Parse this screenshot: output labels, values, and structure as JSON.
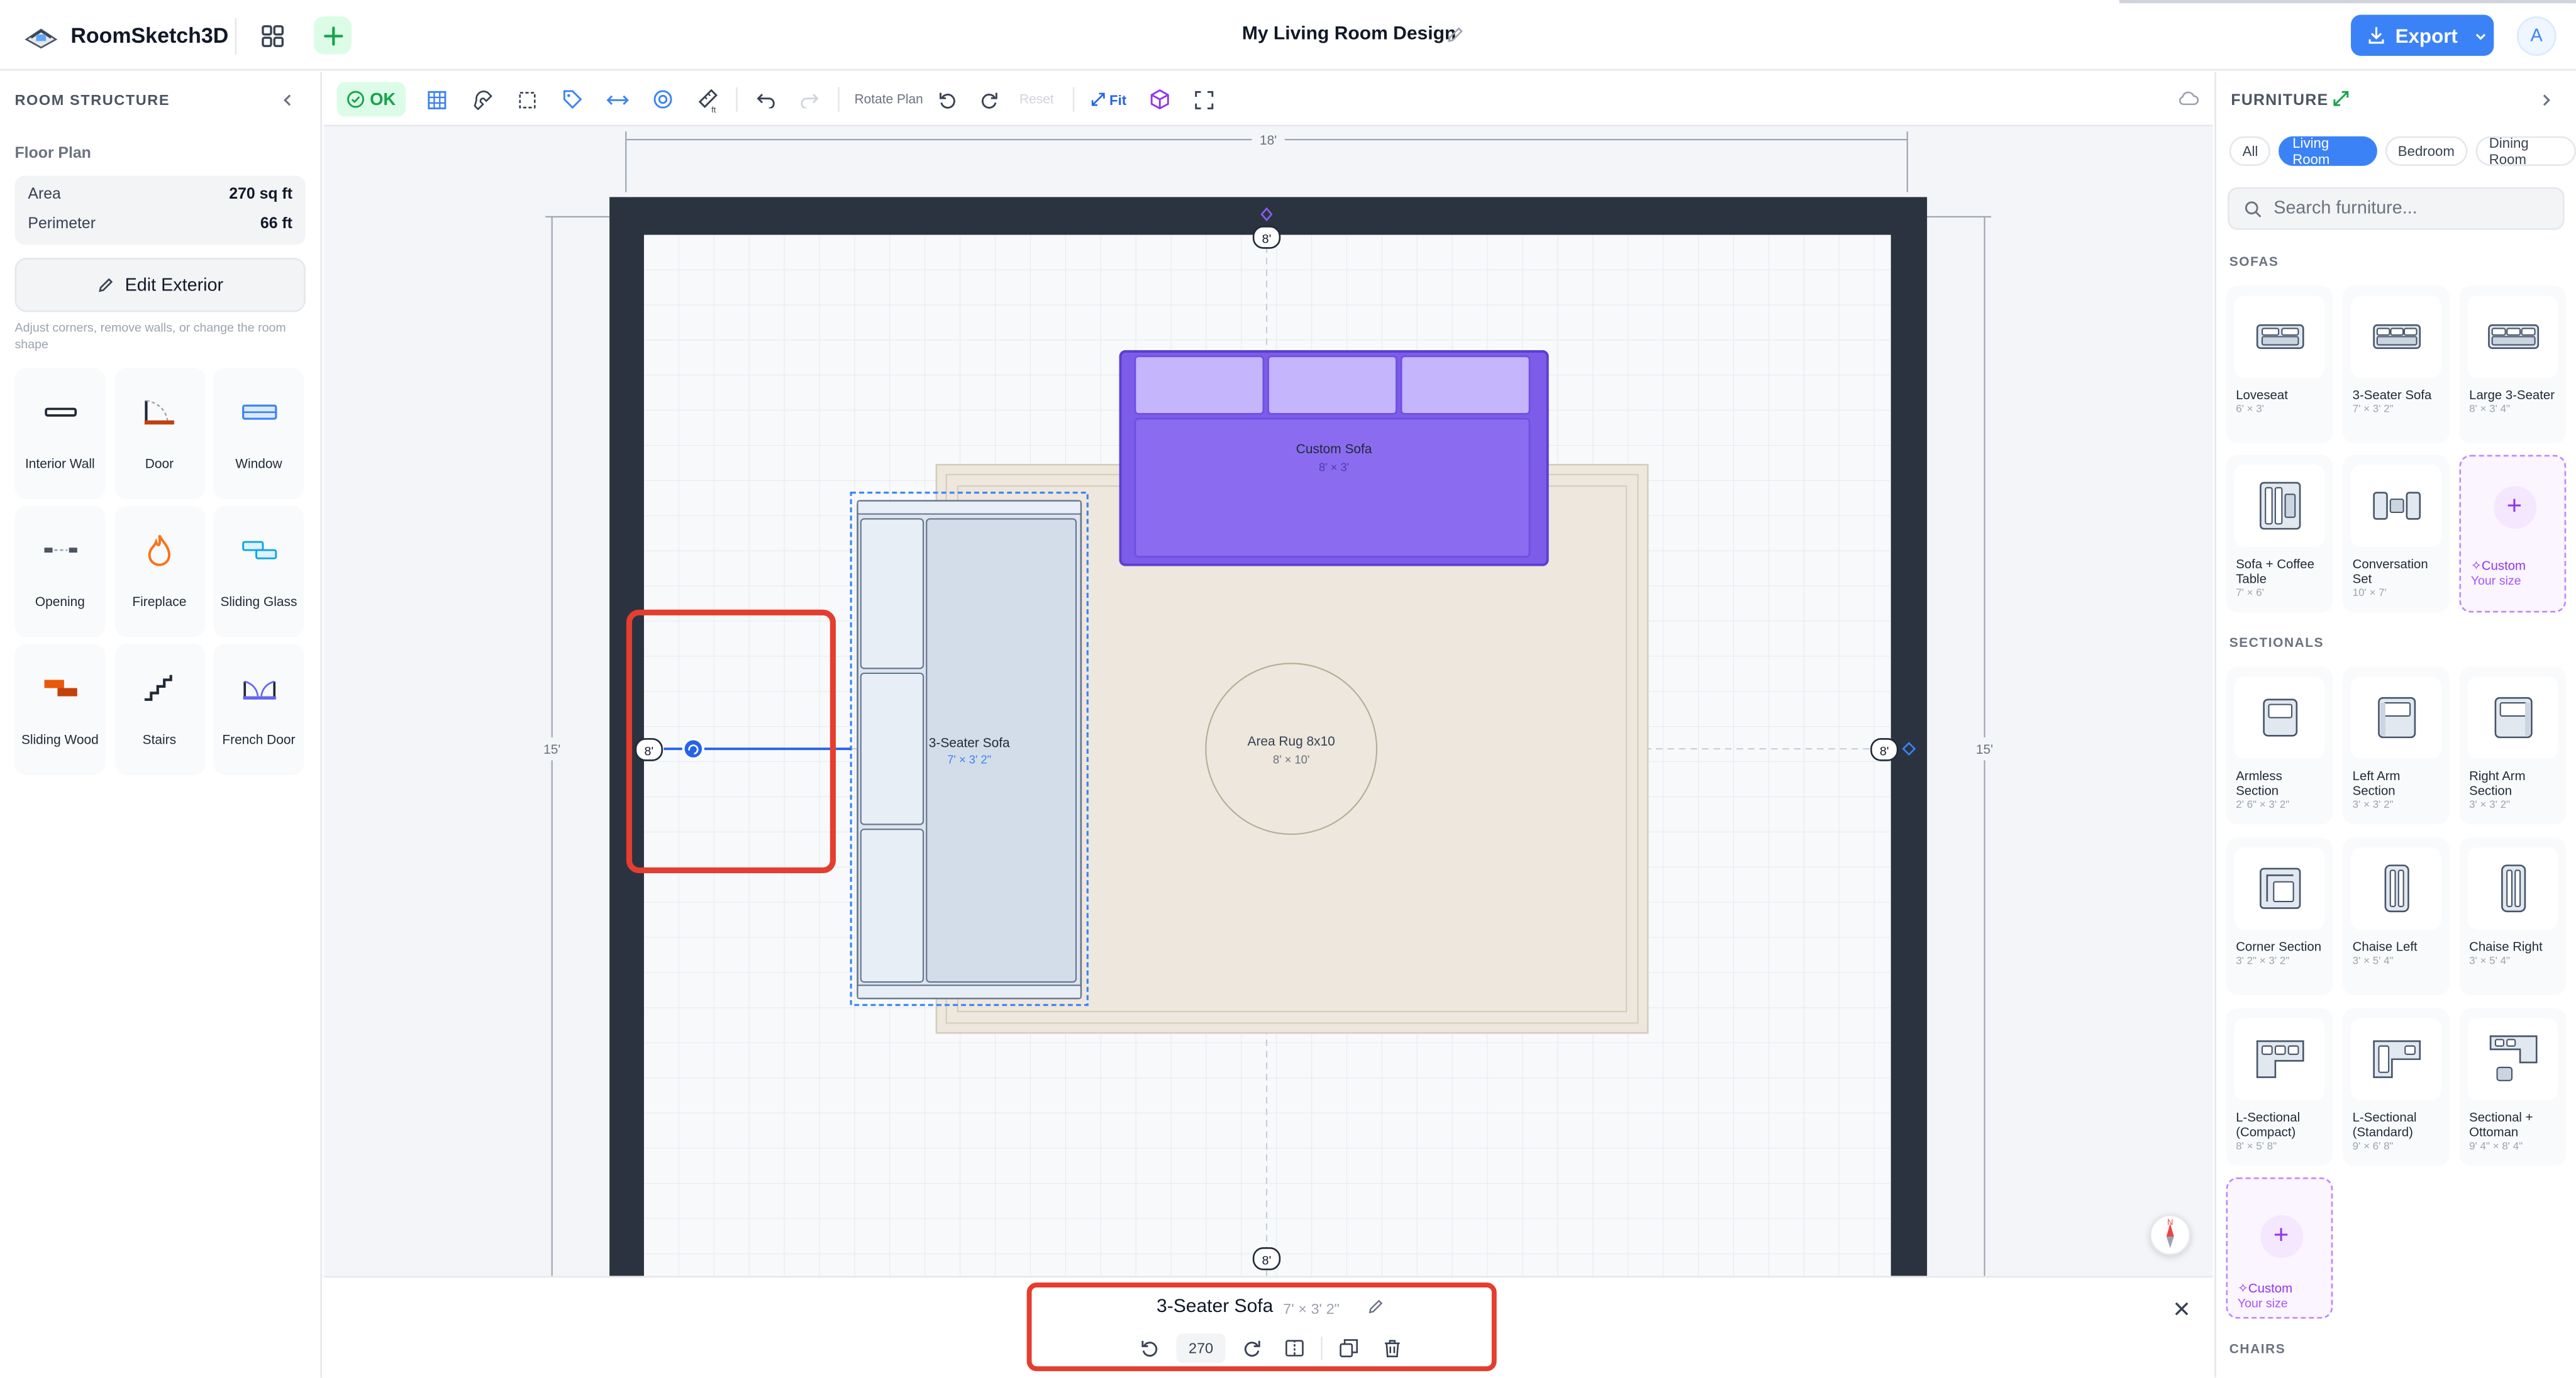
{
  "header": {
    "app_title": "RoomSketch3D",
    "doc_title": "My Living Room Design",
    "export_label": "Export",
    "avatar_initial": "A"
  },
  "left_panel": {
    "heading": "ROOM STRUCTURE",
    "floor_plan_label": "Floor Plan",
    "area_label": "Area",
    "area_value": "270 sq ft",
    "perimeter_label": "Perimeter",
    "perimeter_value": "66 ft",
    "edit_exterior_label": "Edit Exterior",
    "edit_hint": "Adjust corners, remove walls, or change the room shape",
    "tools": [
      {
        "label": "Interior Wall",
        "icon": "interior-wall-icon"
      },
      {
        "label": "Door",
        "icon": "door-icon"
      },
      {
        "label": "Window",
        "icon": "window-icon"
      },
      {
        "label": "Opening",
        "icon": "opening-icon"
      },
      {
        "label": "Fireplace",
        "icon": "fireplace-icon"
      },
      {
        "label": "Sliding Glass",
        "icon": "sliding-glass-icon"
      },
      {
        "label": "Sliding Wood",
        "icon": "sliding-wood-icon"
      },
      {
        "label": "Stairs",
        "icon": "stairs-icon"
      },
      {
        "label": "French Door",
        "icon": "french-door-icon"
      }
    ]
  },
  "toolbar": {
    "ok_label": "OK",
    "rotate_plan_label": "Rotate Plan",
    "reset_label": "Reset",
    "fit_label": "Fit"
  },
  "canvas": {
    "dim_top": "18'",
    "dim_left": "15'",
    "dim_right": "15'",
    "wall_top_marker": "8'",
    "wall_bottom_marker": "8'",
    "wall_left_marker": "8'",
    "wall_right_marker": "8'",
    "custom_sofa_label": "Custom Sofa",
    "custom_sofa_dim": "8' × 3'",
    "sofa_label": "3-Seater Sofa",
    "sofa_dim": "7' × 3' 2\"",
    "rug_label": "Area Rug 8x10",
    "rug_dim": "8' × 10'",
    "compass_label": "N"
  },
  "right_panel": {
    "heading": "FURNITURE",
    "filters": [
      "All",
      "Living Room",
      "Bedroom",
      "Dining Room"
    ],
    "active_filter": "Living Room",
    "search_placeholder": "Search furniture...",
    "sections": [
      {
        "title": "SOFAS",
        "items": [
          {
            "name": "Loveseat",
            "dim": "6' × 3'"
          },
          {
            "name": "3-Seater Sofa",
            "dim": "7' × 3' 2\""
          },
          {
            "name": "Large 3-Seater",
            "dim": "8' × 3' 4\""
          },
          {
            "name": "Sofa + Coffee Table",
            "dim": "7' × 6'"
          },
          {
            "name": "Conversation Set",
            "dim": "10' × 7'"
          },
          {
            "name": "Custom",
            "dim": "Your size",
            "custom": true
          }
        ]
      },
      {
        "title": "SECTIONALS",
        "items": [
          {
            "name": "Armless Section",
            "dim": "2' 6\" × 3' 2\""
          },
          {
            "name": "Left Arm Section",
            "dim": "3' × 3' 2\""
          },
          {
            "name": "Right Arm Section",
            "dim": "3' × 3' 2\""
          },
          {
            "name": "Corner Section",
            "dim": "3' 2\" × 3' 2\""
          },
          {
            "name": "Chaise Left",
            "dim": "3' × 5' 4\""
          },
          {
            "name": "Chaise Right",
            "dim": "3' × 5' 4\""
          },
          {
            "name": "L-Sectional (Compact)",
            "dim": "8' × 5' 8\""
          },
          {
            "name": "L-Sectional (Standard)",
            "dim": "9' × 6' 8\""
          },
          {
            "name": "Sectional + Ottoman",
            "dim": "9' 4\" × 8' 4\""
          },
          {
            "name": "Custom",
            "dim": "Your size",
            "custom": true
          }
        ]
      },
      {
        "title": "CHAIRS",
        "items": []
      }
    ]
  },
  "selection": {
    "name": "3-Seater Sofa",
    "dim": "7' × 3' 2\"",
    "rotation": "270"
  },
  "colors": {
    "accent": "#3b82f6",
    "wall": "#2b3340",
    "custom_sofa": "#7c5ce8",
    "selected_sofa": "#dbe4ef",
    "highlight": "#e53d2f",
    "custom_purple": "#9333ea"
  }
}
